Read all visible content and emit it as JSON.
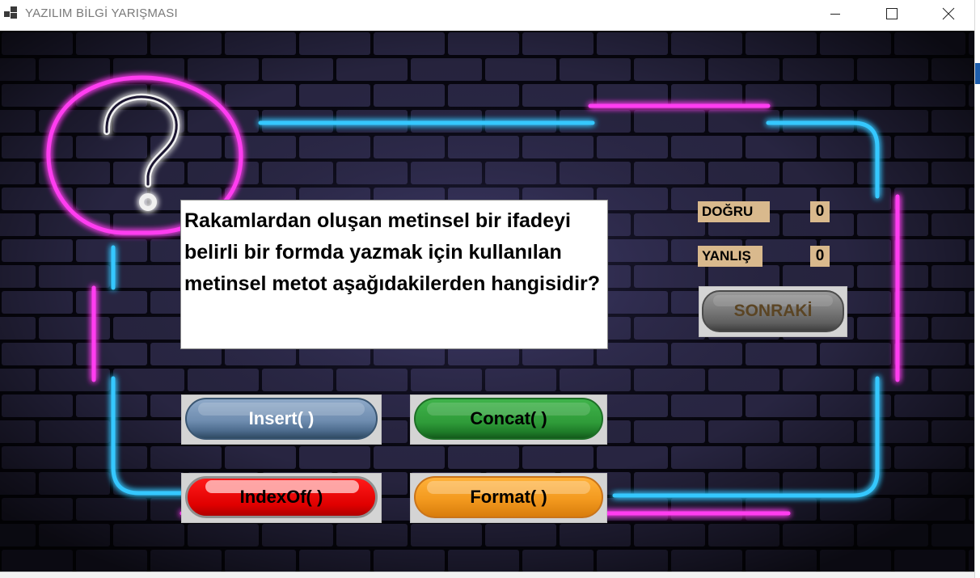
{
  "window": {
    "title": "YAZILIM BİLGİ YARIŞMASI",
    "controls": [
      "minimize",
      "maximize",
      "close"
    ]
  },
  "question": {
    "text": "Rakamlardan oluşan metinsel bir ifadeyi belirli bir formda yazmak için kullanılan metinsel metot aşağıdakilerden hangisidir?"
  },
  "answers": [
    {
      "label": "Insert( )",
      "color": "#6f8db0"
    },
    {
      "label": "Concat( )",
      "color": "#2f9b39"
    },
    {
      "label": "IndexOf( )",
      "color": "#e00000"
    },
    {
      "label": "Format( )",
      "color": "#f39a1f"
    }
  ],
  "score": {
    "correct_label": "DOĞRU",
    "correct_value": "0",
    "wrong_label": "YANLIŞ",
    "wrong_value": "0"
  },
  "next_button": {
    "label": "SONRAKİ"
  },
  "colors": {
    "neon_pink": "#ff3df0",
    "neon_blue": "#33c6ff",
    "score_bg": "#d9b98d"
  },
  "icons": {
    "app": "window-icon",
    "background": "neon-question-mark-icon"
  }
}
